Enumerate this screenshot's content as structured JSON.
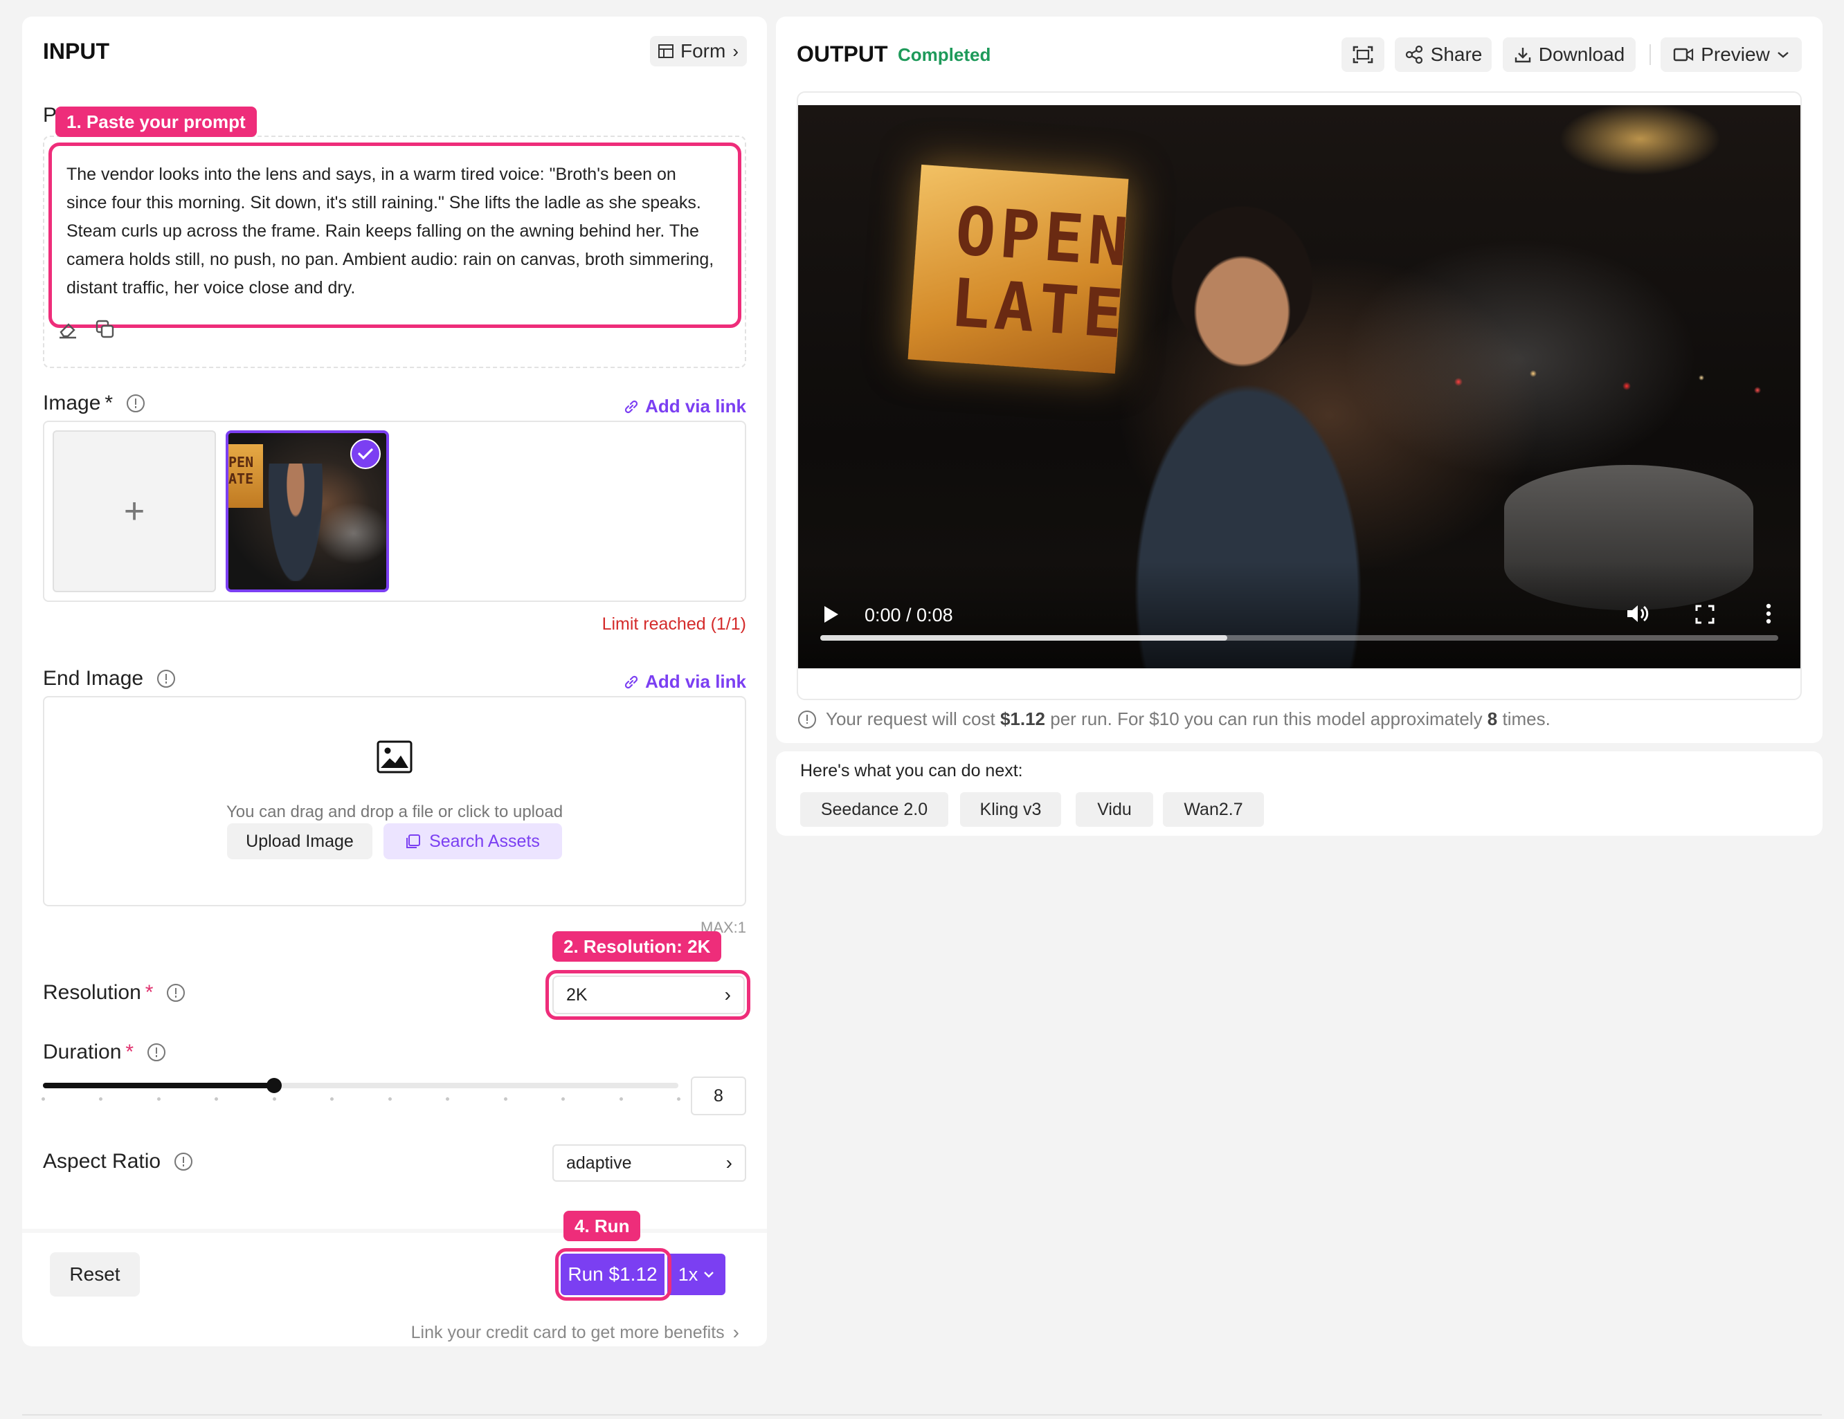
{
  "input": {
    "title": "INPUT",
    "form_label": "Form",
    "prompt": {
      "label_partial": "P",
      "text": "The vendor looks into the lens and says, in a warm tired voice: \"Broth's been on since four this morning. Sit down, it's still raining.\" She lifts the ladle as she speaks. Steam curls up across the frame. Rain keeps falling on the awning behind her. The camera holds still, no push, no pan. Ambient audio: rain on canvas, broth simmering, distant traffic, her voice close and dry."
    },
    "image": {
      "label": "Image",
      "required_mark": "*",
      "add_link": "Add via link",
      "limit_text": "Limit reached (1/1)",
      "thumb_text": "PEN ATE"
    },
    "end_image": {
      "label": "End Image",
      "add_link": "Add via link",
      "hint": "You can drag and drop a file or click to upload",
      "upload_button": "Upload Image",
      "search_button": "Search Assets",
      "max_label": "MAX:1"
    },
    "resolution": {
      "label": "Resolution",
      "required_mark": "*",
      "value": "2K"
    },
    "duration": {
      "label": "Duration",
      "required_mark": "*",
      "value": "8",
      "fraction": 0.364
    },
    "aspect_ratio": {
      "label": "Aspect Ratio",
      "value": "adaptive"
    },
    "footer": {
      "reset": "Reset",
      "run": "Run $1.12",
      "multiplier": "1x",
      "credit_link": "Link your credit card to get more benefits"
    }
  },
  "annotations": {
    "step1": "1. Paste your prompt",
    "step2": "2. Resolution: 2K",
    "step4": "4. Run"
  },
  "output": {
    "title": "OUTPUT",
    "status": "Completed",
    "share": "Share",
    "download": "Download",
    "preview": "Preview",
    "video": {
      "sign_line1": "OPEN",
      "sign_line2": "LATE",
      "time": "0:00 / 0:08",
      "progress": 0.425
    },
    "cost_prefix": "Your request will cost ",
    "cost_value": "$1.12",
    "cost_mid": " per run. For $10 you can run this model approximately ",
    "cost_times": "8",
    "cost_suffix": " times."
  },
  "next": {
    "title": "Here's what you can do next:",
    "chips": [
      "Seedance 2.0",
      "Kling v3",
      "Vidu",
      "Wan2.7"
    ]
  },
  "colors": {
    "accent": "#7b3ff2",
    "annotation": "#ee2d7a",
    "success": "#1e9a5a",
    "error": "#d42b2b"
  }
}
